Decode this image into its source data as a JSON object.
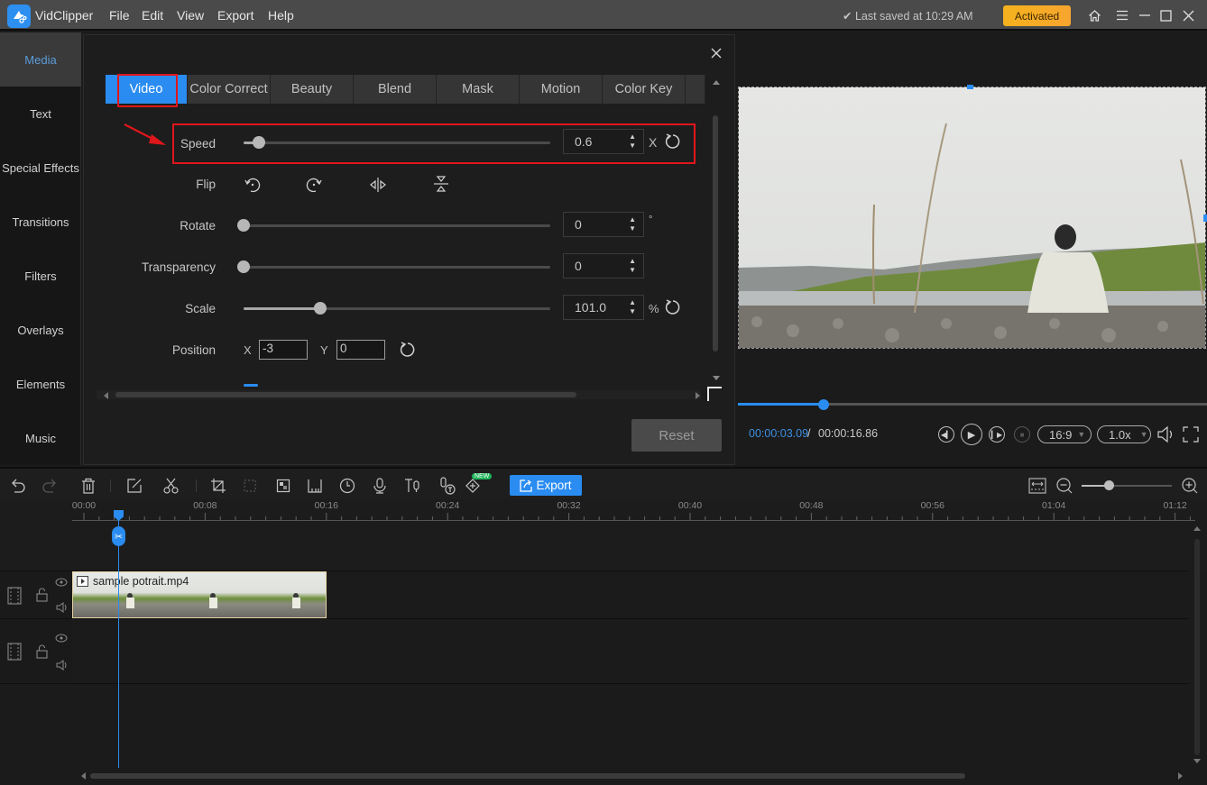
{
  "titlebar": {
    "app_name": "VidClipper",
    "menus": [
      "File",
      "Edit",
      "View",
      "Export",
      "Help"
    ],
    "saved_status": "✔ Last saved at 10:29 AM",
    "activated_label": "Activated",
    "icons": [
      "home-icon",
      "menu-icon",
      "minimize-icon",
      "maximize-icon",
      "close-icon"
    ]
  },
  "sidebar": {
    "items": [
      {
        "label": "Media",
        "active": true
      },
      {
        "label": "Text"
      },
      {
        "label": "Special Effects"
      },
      {
        "label": "Transitions"
      },
      {
        "label": "Filters"
      },
      {
        "label": "Overlays"
      },
      {
        "label": "Elements"
      },
      {
        "label": "Music"
      }
    ]
  },
  "panel": {
    "tabs": [
      "Video",
      "Color Correct",
      "Beauty",
      "Blend",
      "Mask",
      "Motion",
      "Color Key"
    ],
    "active_tab": "Video",
    "speed": {
      "label": "Speed",
      "value": "0.6",
      "unit": "X",
      "slider_fraction": 0.05
    },
    "flip": {
      "label": "Flip",
      "buttons": [
        "rotate-left",
        "rotate-right",
        "flip-horizontal",
        "flip-vertical"
      ]
    },
    "rotate": {
      "label": "Rotate",
      "value": "0",
      "unit": "°",
      "slider_fraction": 0.0
    },
    "transparency": {
      "label": "Transparency",
      "value": "0",
      "slider_fraction": 0.0
    },
    "scale": {
      "label": "Scale",
      "value": "101.0",
      "unit": "%",
      "slider_fraction": 0.25
    },
    "position": {
      "label": "Position",
      "x_label": "X",
      "x_value": "-3",
      "y_label": "Y",
      "y_value": "0"
    },
    "reset_label": "Reset"
  },
  "player": {
    "current_time": "00:00:03.09",
    "separator": " / ",
    "total_time": "00:00:16.86",
    "progress_fraction": 0.183,
    "aspect_ratio": "16:9",
    "playback_speed": "1.0x"
  },
  "toolbar": {
    "export_label": "Export",
    "new_badge": "NEW",
    "zoom_fraction": 0.3
  },
  "timeline": {
    "ruler_labels": [
      "00:00",
      "00:08",
      "00:16",
      "00:24",
      "00:32",
      "00:40",
      "00:48",
      "00:56",
      "01:04",
      "01:12"
    ],
    "clip_name": "sample potrait.mp4"
  }
}
